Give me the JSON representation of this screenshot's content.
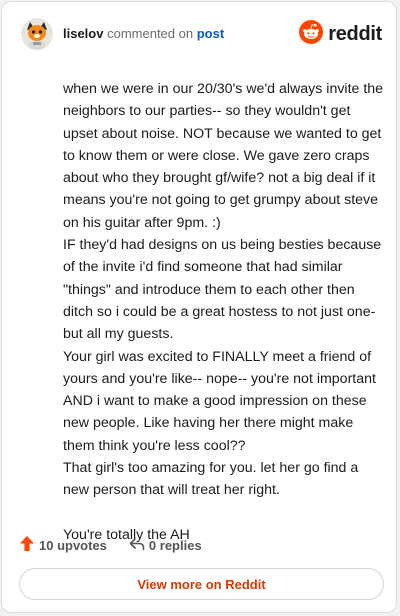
{
  "header": {
    "username": "liselov",
    "action": "commented on",
    "link": "post",
    "brand": "reddit"
  },
  "comment": {
    "paragraphs": [
      "when we were in our 20/30's we'd always invite the neighbors to our parties-- so they wouldn't get upset about noise. NOT because we wanted to get to know them or were close. We gave zero craps about who they brought gf/wife? not a big deal if it means you're not going to get grumpy about steve on his guitar after 9pm. :)",
      "IF they'd had designs on us being besties because of the invite i'd find someone that had similar \"things\" and introduce them to each other then ditch so i could be a great hostess to not just one- but all my guests.",
      "Your girl was excited to FINALLY meet a friend of yours and you're like-- nope-- you're not important AND i want to make a good impression on these new people. Like having her there might make them think you're less cool??",
      "That girl's too amazing for you. let her go find a new person that will treat her right.",
      "",
      "You're totally the AH"
    ]
  },
  "footer": {
    "upvotes": "10 upvotes",
    "replies": "0 replies",
    "view_more": "View more on Reddit"
  },
  "colors": {
    "brand_orange": "#ff4500",
    "upvote_orange": "#ff4500",
    "link_blue": "#0a57d0",
    "view_more_text": "#d93a00"
  },
  "icons": {
    "avatar": "user-avatar",
    "brand": "reddit-snoo-icon",
    "upvote": "upvote-arrow-icon",
    "reply": "reply-arrow-icon"
  }
}
